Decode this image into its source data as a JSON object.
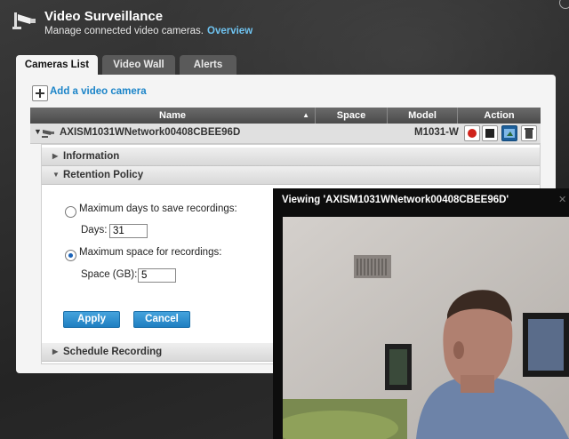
{
  "app": {
    "title": "Video Surveillance",
    "subtitle": "Manage connected video cameras.",
    "overview_link": "Overview"
  },
  "tabs": [
    {
      "label": "Cameras List",
      "active": true
    },
    {
      "label": "Video Wall",
      "active": false
    },
    {
      "label": "Alerts",
      "active": false
    }
  ],
  "toolbar": {
    "add_camera": "Add a video camera"
  },
  "grid": {
    "columns": [
      "Name",
      "Space",
      "Model",
      "Action"
    ],
    "rows": [
      {
        "name": "AXISM1031WNetwork00408CBEE96D",
        "space": "",
        "model": "M1031-W"
      }
    ]
  },
  "detail": {
    "sections": {
      "information": "Information",
      "retention": "Retention Policy",
      "schedule": "Schedule Recording"
    },
    "retention": {
      "option_days": "Maximum days to save recordings:",
      "days_label": "Days:",
      "days_value": "31",
      "option_space": "Maximum space for recordings:",
      "space_label": "Space (GB):",
      "space_value": "5",
      "apply": "Apply",
      "cancel": "Cancel"
    }
  },
  "viewer": {
    "title": "Viewing 'AXISM1031WNetwork00408CBEE96D'"
  },
  "colors": {
    "accent_blue": "#1b84c8",
    "link_blue": "#6fc3f0",
    "record_red": "#d0231b"
  }
}
